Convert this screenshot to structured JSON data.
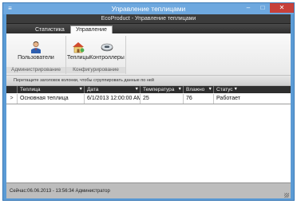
{
  "window": {
    "title": "Управление теплицами",
    "minimize": "–",
    "restore": "□",
    "close": "✕"
  },
  "app": {
    "title": "EcoProduct - Управление теплицами"
  },
  "tabs": [
    {
      "label": "Статистика",
      "active": false
    },
    {
      "label": "Управление",
      "active": true
    }
  ],
  "ribbon": {
    "groups": [
      {
        "label": "Администрирование",
        "buttons": [
          {
            "label": "Пользователи",
            "icon": "user-icon"
          }
        ]
      },
      {
        "label": "Конфигурирование",
        "buttons": [
          {
            "label": "Теплицы",
            "icon": "greenhouse-icon"
          },
          {
            "label": "Контроллеры",
            "icon": "controller-icon"
          }
        ]
      }
    ]
  },
  "group_hint": "Перетащите заголовок колонки, чтобы сгруппировать данные по ней",
  "grid": {
    "columns": [
      "Теплица",
      "Дата",
      "Температура",
      "Влажно",
      "Статус"
    ],
    "rows": [
      [
        "Основная теплица",
        "6/1/2013 12:00:00 AM",
        "25",
        "76",
        "Работает"
      ]
    ],
    "row_indicator": ">"
  },
  "status": {
    "text": "Сейчас:06.06.2013 - 13:56:34  Администратор"
  },
  "colors": {
    "window_frame": "#5b9bd5",
    "close_button": "#c7403a",
    "dark_header": "#2e2e2e"
  }
}
